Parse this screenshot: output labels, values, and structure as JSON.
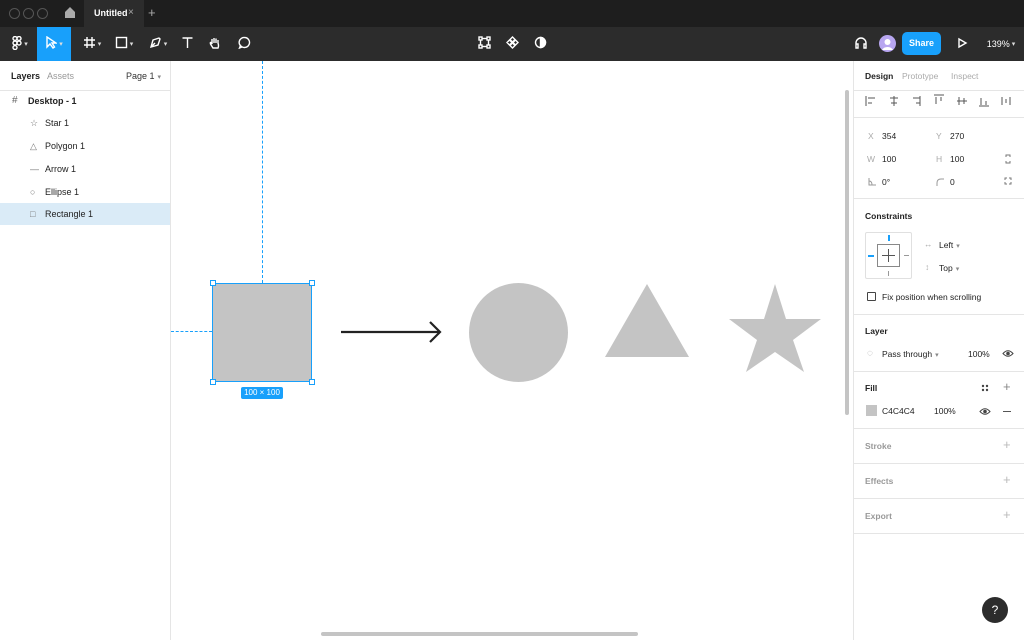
{
  "window": {
    "tab_title": "Untitled"
  },
  "toolbar": {
    "share_label": "Share",
    "zoom": "139%"
  },
  "left_panel": {
    "tabs": [
      "Layers",
      "Assets"
    ],
    "page_selector": "Page 1",
    "frame_name": "Desktop - 1",
    "layers": [
      {
        "name": "Star 1",
        "icon": "star-icon"
      },
      {
        "name": "Polygon 1",
        "icon": "triangle-icon"
      },
      {
        "name": "Arrow 1",
        "icon": "line-icon"
      },
      {
        "name": "Ellipse 1",
        "icon": "ellipse-icon"
      },
      {
        "name": "Rectangle 1",
        "icon": "rectangle-icon"
      }
    ]
  },
  "canvas": {
    "size_label": "100 × 100"
  },
  "design_panel": {
    "tabs": [
      "Design",
      "Prototype",
      "Inspect"
    ],
    "x_label": "X",
    "x": "354",
    "y_label": "Y",
    "y": "270",
    "w_label": "W",
    "w": "100",
    "h_label": "H",
    "h": "100",
    "rotation": "0°",
    "radius": "0",
    "constraints_title": "Constraints",
    "constraint_h": "Left",
    "constraint_v": "Top",
    "fix_position": "Fix position when scrolling",
    "layer_title": "Layer",
    "blend_mode": "Pass through",
    "layer_opacity": "100%",
    "fill_title": "Fill",
    "fill_hex": "C4C4C4",
    "fill_opacity": "100%",
    "stroke_title": "Stroke",
    "effects_title": "Effects",
    "export_title": "Export"
  },
  "colors": {
    "accent": "#18a0fb",
    "shape_fill": "#c4c4c4",
    "selected_row": "#daebf7"
  },
  "help_label": "?"
}
